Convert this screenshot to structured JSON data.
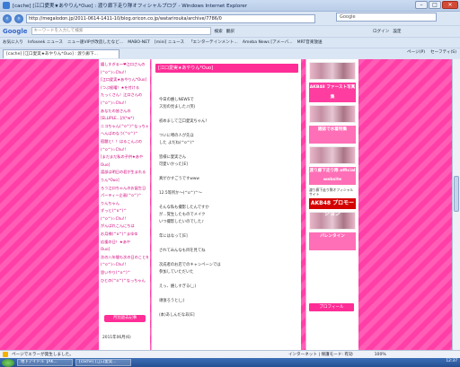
{
  "window": {
    "title": "[cache] [江口愛実★あやりん*Ouo] : 渡り廊下走り隊オフィシャルブログ - Windows Internet Explorer",
    "min": "–",
    "max": "□",
    "close": "✕"
  },
  "address": {
    "url": "http://megalodon.jp/2011-0614-1411-10/blog.oricon.co.jp/watarirouka/archive/7786/0",
    "search_label": "Google"
  },
  "google": {
    "logo": "Google",
    "placeholder": "キーワードを入力して検索",
    "items": [
      "検索",
      "翻訳",
      "ログイン",
      "設定"
    ]
  },
  "favorites": {
    "label": "お気に入り",
    "items": [
      "Infoseek ニュース",
      "ニュー速VIPが改造したなど...",
      "MABO-NET",
      "[mini] ニュース",
      "「エンターテインメント...",
      "Ameba News [アメーバ...",
      "MRT音楽放送"
    ]
  },
  "tab": {
    "label": "[cache] [江口愛実★あやりん*Ouo] : 渡り廊下...",
    "tools": [
      "ページ(P)",
      "セーフティ(S)"
    ]
  },
  "left": {
    "lines": [
      "嬉しすぎる〜❤江口さんの",
      "(^o^)☆Chu!!",
      "[江口愛実★あやりん*Ouo]",
      "(つぶ経曜！★を付ける",
      "たっくさん！江口さんの",
      "(^o^)☆Chu!!",
      "あなたの皆さんの",
      "[ELLIPLE...]//(*w*)",
      "ニコちゃん(^o^)^なっちゃ",
      "へんばのなう(^o^)^",
      "宿題と！！はるこんぶの",
      "(^o^)☆Chu!!",
      "[まだまだ私の子供★あや",
      "Ouo]",
      "渡部は明日の君が生まれる",
      "りん*Ouo]",
      "ろう江口ちゃんのお誕生日",
      "パーティー企画(^o^)^",
      "りんちゃん",
      "ずっと(^o^)^",
      "(^o^)☆Chu!!",
      "がんばれこんにちは",
      "お月様(^o^)^まゆゆ",
      "応援の日！★あや",
      "Ouo]",
      "次の八年間も次の日のことを",
      "(^o^)☆Chu!!",
      "思いやり(^o^)^",
      "ひとの(^o^)^なっちゃん"
    ],
    "more_button": "月別過去記事",
    "date": "2011年06月(6)"
  },
  "main": {
    "header": "[江口愛実★あやりん*Ouo]",
    "lines": [
      "今日の嬉しNEWSで",
      "ス別の見ました♪(笑)",
      "",
      "初めまして江口愛実ちゃん！",
      "",
      "ついに噂の人が先ほ",
      "した よだね(^o^)^",
      "",
      "皆様に愛実さん",
      "可愛いかった[E]",
      "",
      "真がかすごうですwww",
      "",
      "12.5等所か〜(^o^)^〜",
      "",
      "そんな私も撮影したんですか",
      "が…覚生したものでメイク",
      "いつ撮影したいのでした♪",
      "",
      "年にはなって[E]",
      "",
      "されてみんなも目を見てね",
      "",
      "次成者のお店でのキャンペーンでは",
      "参加していただいた",
      "",
      "えっ、嬉しすぎる(_;)",
      "",
      "頑張ろうと(_;)",
      "",
      "(本)あしんだなあ[E]"
    ]
  },
  "right": {
    "banner1": "AKB48 ファースト写真集",
    "banner2": "雑誌で水着特集",
    "banner3": "渡り廊下走り隊 official website",
    "small": "渡り廊下走り隊オフィシャルサイト",
    "banner4": "AKB48 プロモーション",
    "banner5": "バレンタイン",
    "profile": "プロフィール"
  },
  "status": {
    "error": "ページでエラーが発生しました。",
    "zone": "インターネット | 保護モード: 有効",
    "zoom": "100%"
  },
  "taskbar": {
    "items": [
      "地下アイドル【AK...",
      "[cache] [江口愛実..."
    ],
    "clock": "12:37"
  }
}
